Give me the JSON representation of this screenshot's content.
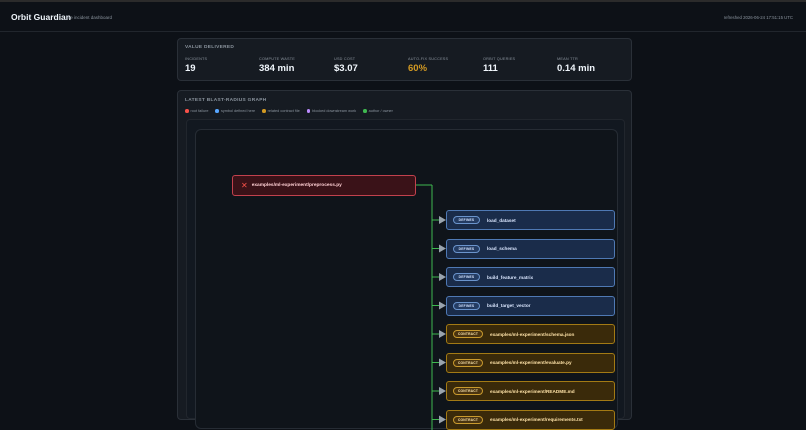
{
  "app": {
    "title": "Orbit Guardian",
    "subtitle": "live incident dashboard",
    "refreshed": "refreshed 2026-06-24 17:51:15 UTC"
  },
  "value_delivered": {
    "title": "VALUE DELIVERED",
    "metrics": [
      {
        "label": "INCIDENTS",
        "value": "19"
      },
      {
        "label": "COMPUTE WASTE",
        "value": "384 min"
      },
      {
        "label": "USD COST",
        "value": "$3.07"
      },
      {
        "label": "AUTO-FIX SUCCESS",
        "value": "60%"
      },
      {
        "label": "ORBIT QUERIES",
        "value": "111"
      },
      {
        "label": "MEAN TTR",
        "value": "0.14 min"
      }
    ],
    "highlight_color": "#d29922"
  },
  "graph": {
    "title": "LATEST BLAST-RADIUS GRAPH",
    "legend": [
      {
        "label": "root failure",
        "color": "#f85149"
      },
      {
        "label": "symbol defined here",
        "color": "#58a6ff"
      },
      {
        "label": "related contract file",
        "color": "#d29922"
      },
      {
        "label": "blocked downstream work",
        "color": "#bc8cff"
      },
      {
        "label": "author / owner",
        "color": "#3fb950"
      }
    ],
    "root": {
      "icon": "x-icon",
      "label": "examples/ml-experiment/preprocess.py"
    },
    "nodes": [
      {
        "kind": "DEFINES",
        "label": "load_dataset"
      },
      {
        "kind": "DEFINES",
        "label": "load_schema"
      },
      {
        "kind": "DEFINES",
        "label": "build_feature_matrix"
      },
      {
        "kind": "DEFINES",
        "label": "build_target_vector"
      },
      {
        "kind": "CONTRACT",
        "label": "examples/ml-experiment/schema.json"
      },
      {
        "kind": "CONTRACT",
        "label": "examples/ml-experiment/evaluate.py"
      },
      {
        "kind": "CONTRACT",
        "label": "examples/ml-experiment/README.md"
      },
      {
        "kind": "CONTRACT",
        "label": "examples/ml-experiment/requirements.txt"
      }
    ],
    "wire_color": "#3fb950",
    "arrow_color": "#9aa4ae"
  }
}
